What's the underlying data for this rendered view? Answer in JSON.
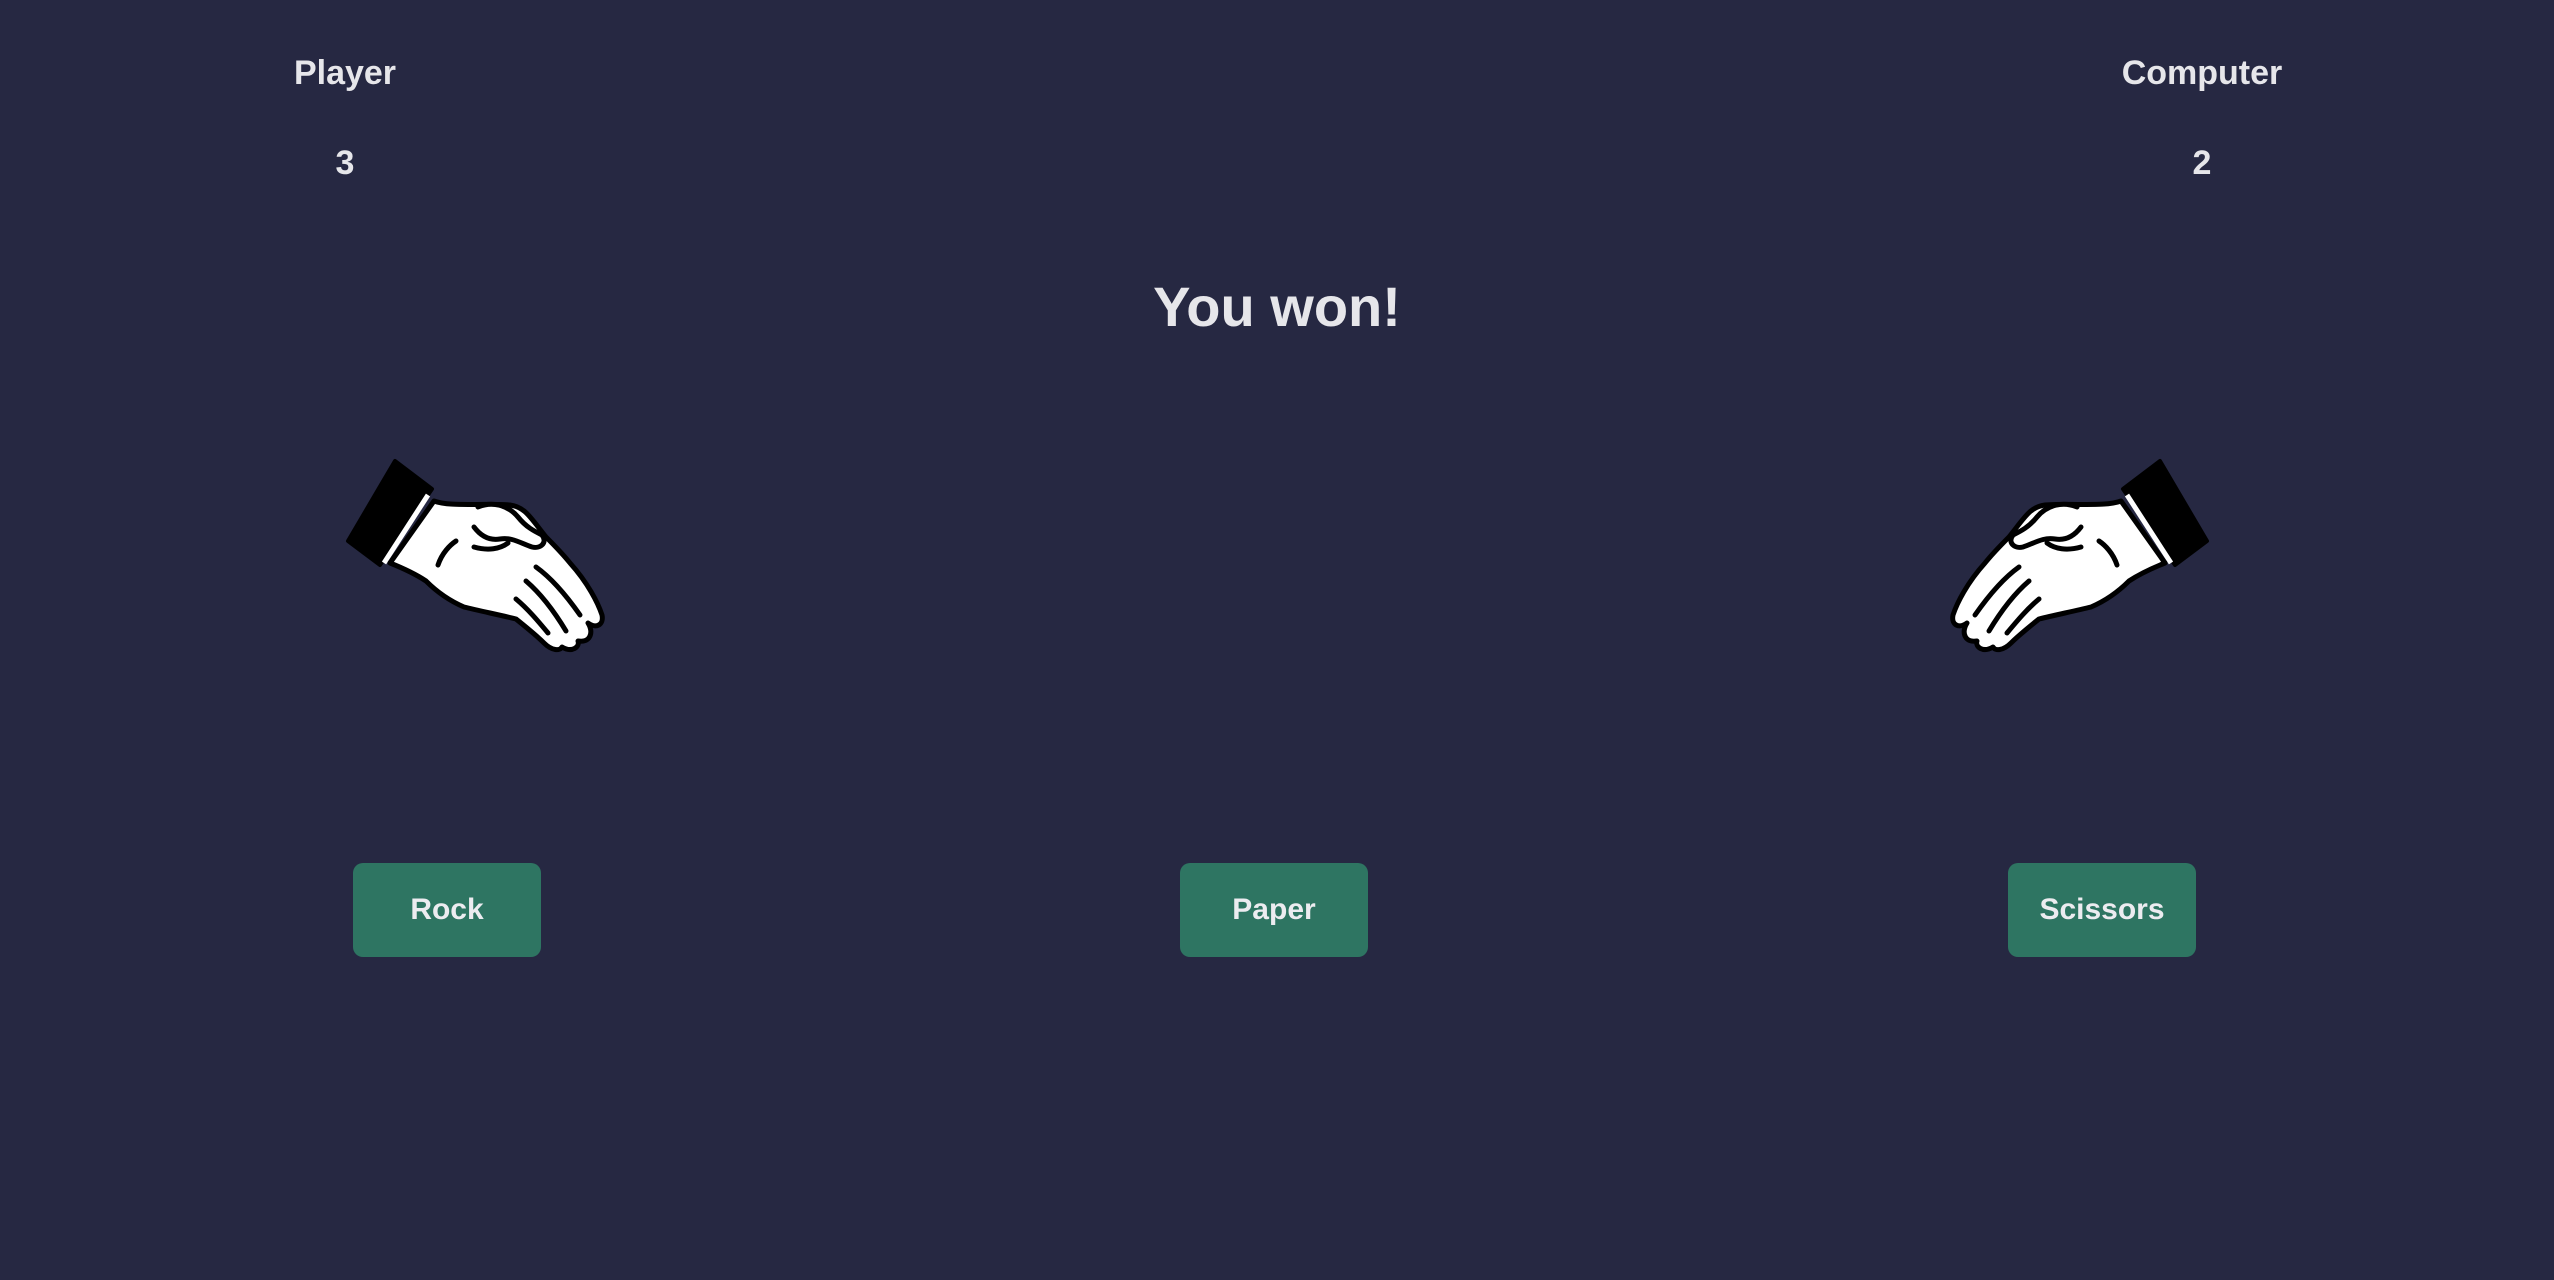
{
  "scoreboard": {
    "player": {
      "label": "Player",
      "score": "3"
    },
    "computer": {
      "label": "Computer",
      "score": "2"
    }
  },
  "result": {
    "message": "You won!"
  },
  "hands": {
    "player": {
      "icon": "paper-hand-icon"
    },
    "computer": {
      "icon": "paper-hand-icon"
    }
  },
  "controls": {
    "rock_label": "Rock",
    "paper_label": "Paper",
    "scissors_label": "Scissors"
  },
  "colors": {
    "background": "#262842",
    "text": "#e6e6ea",
    "button": "#2e7562"
  }
}
